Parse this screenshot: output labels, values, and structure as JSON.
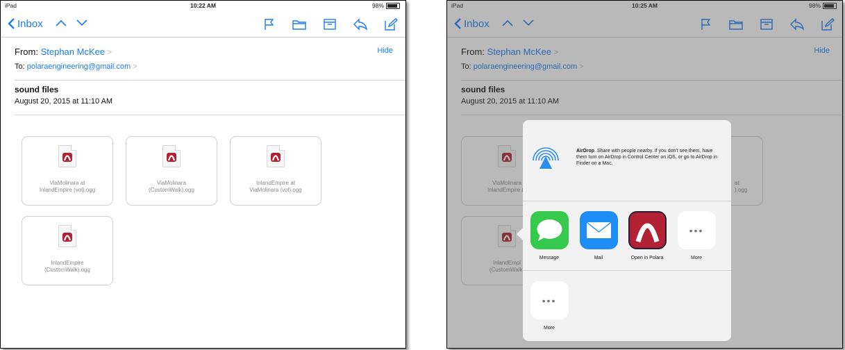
{
  "left": {
    "status": {
      "carrier": "iPad",
      "time": "10:22 AM",
      "battery": "98%"
    },
    "nav": {
      "back_label": "Inbox"
    },
    "header": {
      "from_label": "From:",
      "from_name": "Stephan McKee",
      "to_label": "To:",
      "to_address": "polaraengineering@gmail.com",
      "hide_label": "Hide"
    },
    "subject": "sound files",
    "date": "August 20, 2015 at 11:10 AM",
    "attachments": [
      {
        "line1": "ViaMolinara at",
        "line2": "InlandEmpire (vol).ogg"
      },
      {
        "line1": "ViaMolinara",
        "line2": "(CustomWalk).ogg"
      },
      {
        "line1": "InlandEmpire at",
        "line2": "ViaMolinara (vol).ogg"
      },
      {
        "line1": "InlandEmpire",
        "line2": "(CustomWalk).ogg"
      }
    ]
  },
  "right": {
    "status": {
      "carrier": "iPad",
      "time": "10:25 AM",
      "battery": "98%"
    },
    "nav": {
      "back_label": "Inbox"
    },
    "header": {
      "from_label": "From:",
      "from_name": "Stephan McKee",
      "to_label": "To:",
      "to_address": "polaraengineering@gmail.com",
      "hide_label": "Hide"
    },
    "subject": "sound files",
    "date": "August 20, 2015 at 11:10 AM",
    "visible_attachments": [
      {
        "line1": "ViaMolinara",
        "line2": "InlandEmpire (v"
      },
      {
        "line1": "at",
        "line2": ").ogg"
      },
      {
        "line1": "InlandEmpi",
        "line2": "(CustomWalk)"
      }
    ],
    "share_sheet": {
      "airdrop_title": "AirDrop",
      "airdrop_text": ". Share with people nearby. If you don't see them, have them turn on AirDrop in Control Center on iOS, or go to AirDrop in Finder on a Mac.",
      "apps": [
        {
          "label": "Message",
          "icon": "message-icon"
        },
        {
          "label": "Mail",
          "icon": "mail-icon"
        },
        {
          "label": "Open in Polara",
          "icon": "polara-icon"
        },
        {
          "label": "More",
          "icon": "more-icon"
        }
      ],
      "actions": [
        {
          "label": "More",
          "icon": "more-icon"
        }
      ]
    }
  },
  "colors": {
    "ios_blue": "#1a7cf5",
    "polara_red": "#b22234",
    "message_green": "#35c94e",
    "mail_blue": "#1e8df5"
  }
}
